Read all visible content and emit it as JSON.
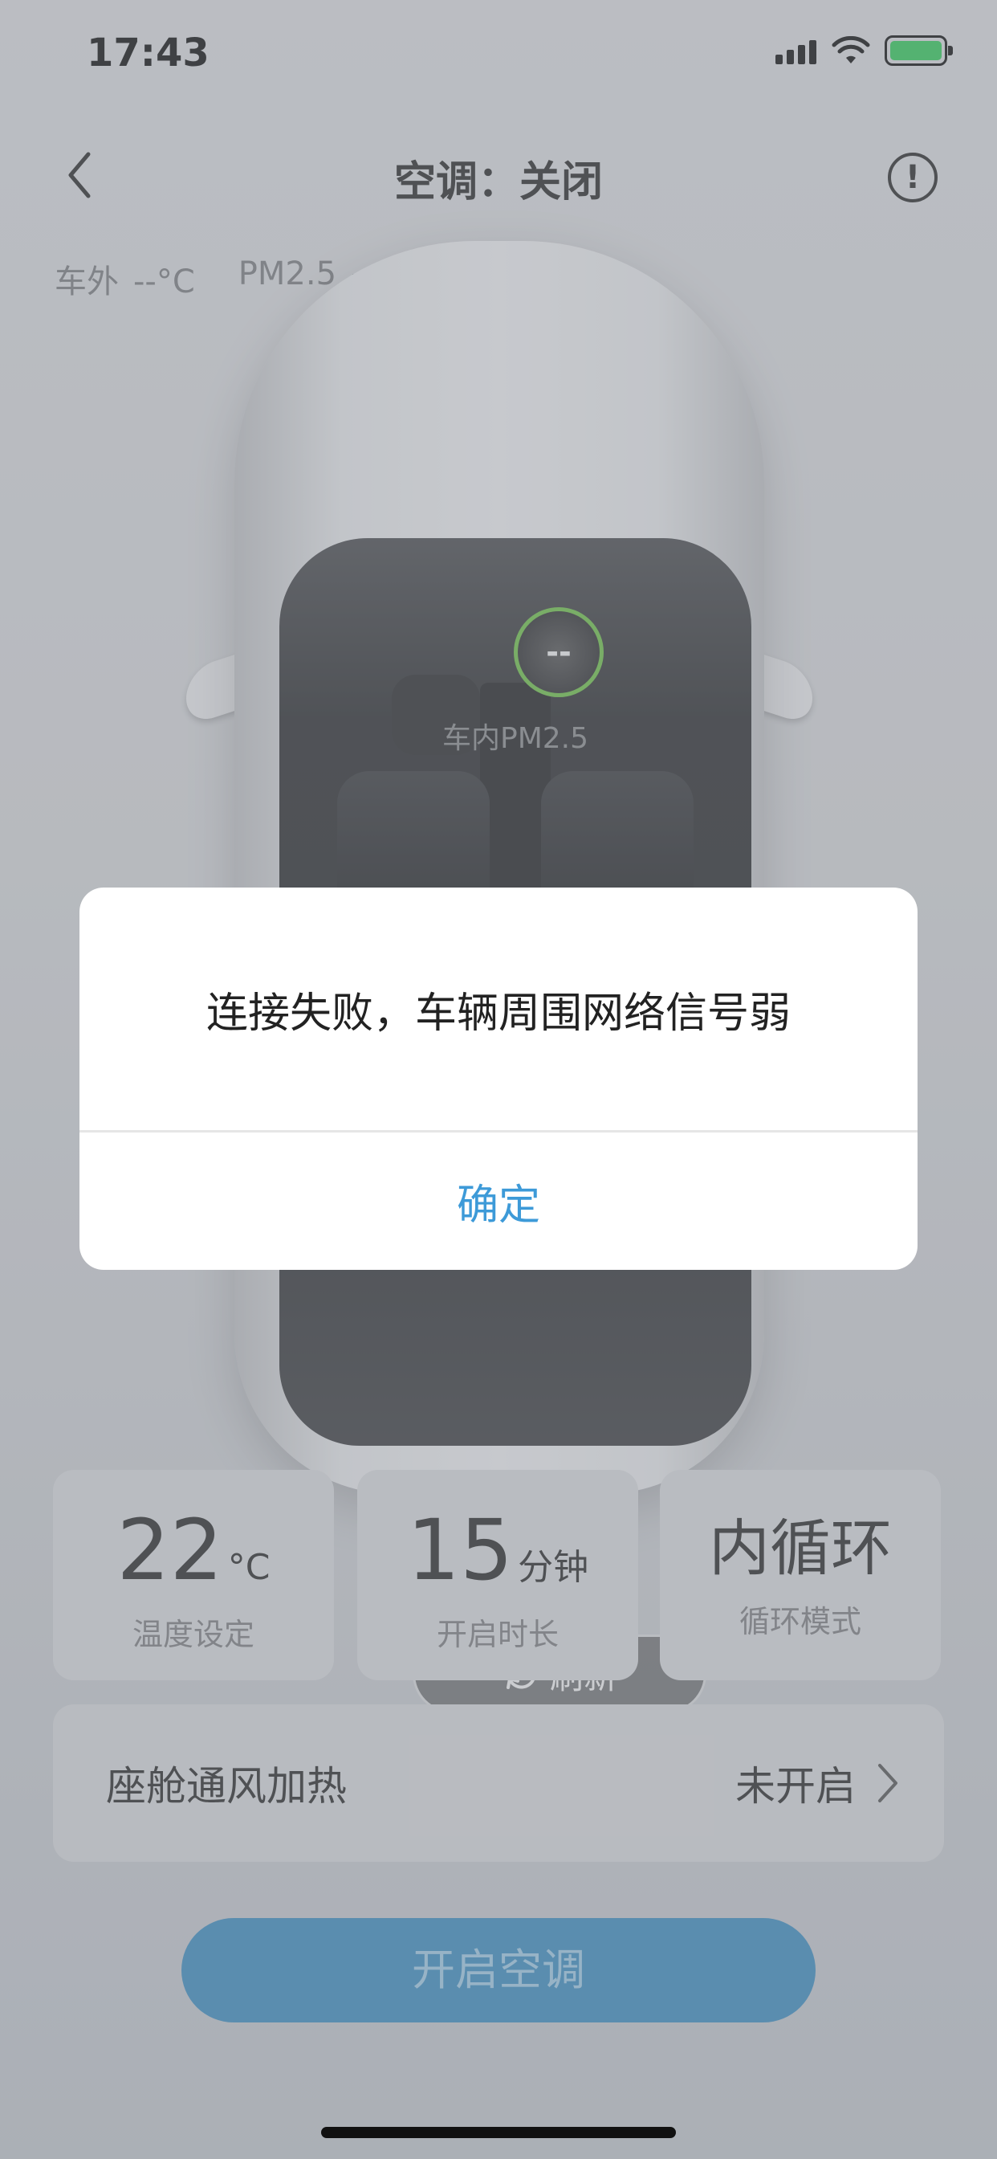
{
  "status_bar": {
    "time": "17:43"
  },
  "nav": {
    "title": "空调：关闭"
  },
  "outside": {
    "temp_label": "车外",
    "temp_value": "--°C",
    "pm_label": "PM2.5",
    "pm_value": "--"
  },
  "car": {
    "pm_inside_value": "--",
    "pm_inside_label": "车内PM2.5",
    "refresh_label": "刷新"
  },
  "cards": {
    "temperature": {
      "value": "22",
      "unit": "°C",
      "label": "温度设定"
    },
    "duration": {
      "value": "15",
      "unit": "分钟",
      "label": "开启时长"
    },
    "cycle": {
      "value": "内循环",
      "label": "循环模式"
    }
  },
  "cabin_row": {
    "label": "座舱通风加热",
    "status": "未开启"
  },
  "start_button": {
    "label": "开启空调"
  },
  "dialog": {
    "message": "连接失败，车辆周围网络信号弱",
    "confirm": "确定"
  },
  "colors": {
    "accent": "#3d8bbd",
    "dialog_link": "#3d9ad8",
    "pm_ring": "#6fbf4a"
  }
}
